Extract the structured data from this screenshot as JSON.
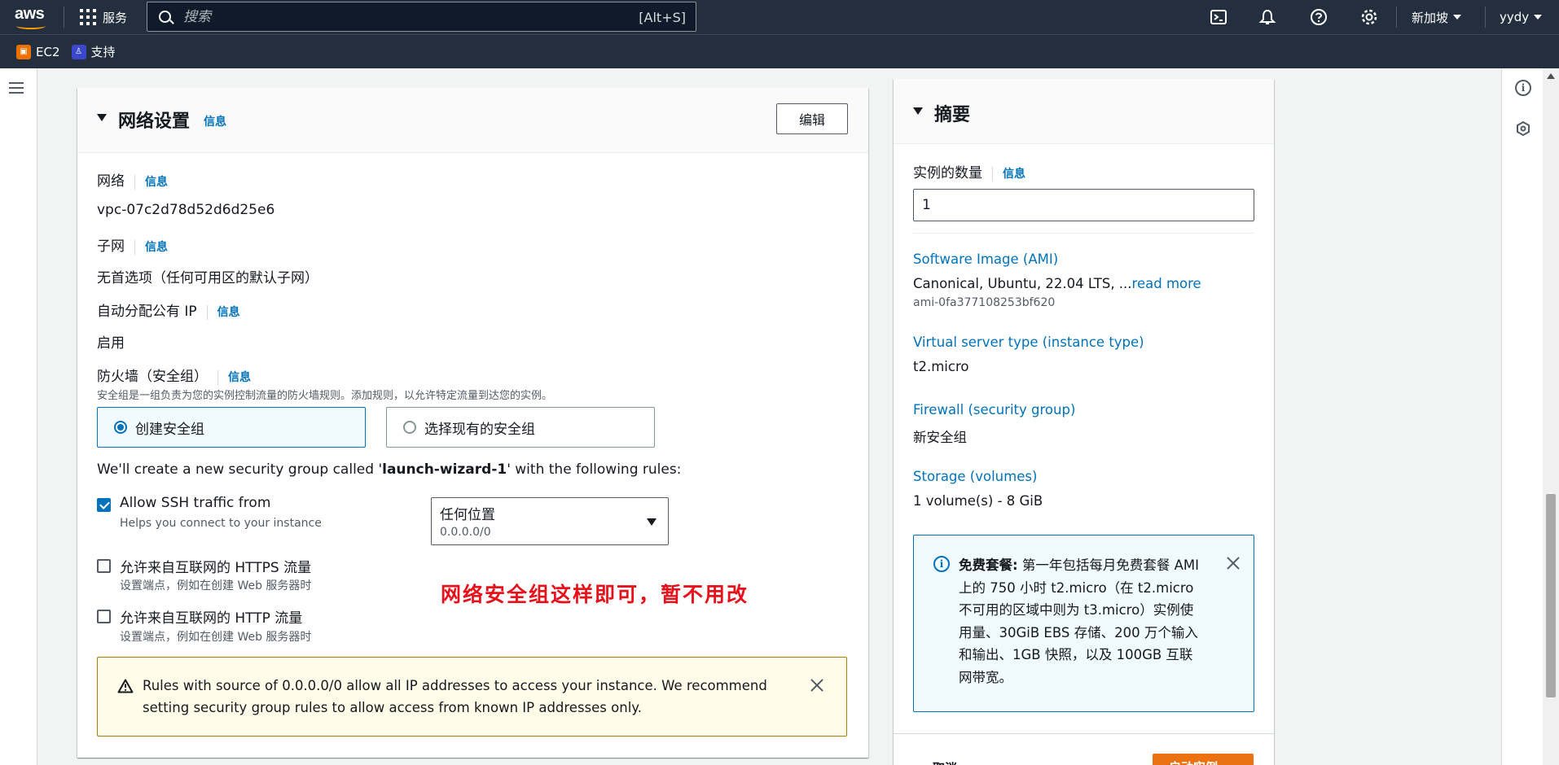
{
  "topnav": {
    "logo": "aws",
    "services_label": "服务",
    "search_placeholder": "搜索",
    "search_shortcut": "[Alt+S]",
    "region": "新加坡",
    "user": "yydy",
    "icons": [
      "cloudshell-icon",
      "bell-icon",
      "help-icon",
      "gear-icon"
    ]
  },
  "favorites": [
    {
      "label": "EC2",
      "color": "#ed7100"
    },
    {
      "label": "支持",
      "color": "#3b48cc"
    }
  ],
  "network": {
    "title": "网络设置",
    "info": "信息",
    "edit_button": "编辑",
    "network_label": "网络",
    "network_info": "信息",
    "network_value": "vpc-07c2d78d52d6d25e6",
    "subnet_label": "子网",
    "subnet_info": "信息",
    "subnet_value": "无首选项（任何可用区的默认子网）",
    "public_ip_label": "自动分配公有 IP",
    "public_ip_info": "信息",
    "public_ip_value": "启用",
    "firewall_label": "防火墙（安全组）",
    "firewall_info": "信息",
    "firewall_desc": "安全组是一组负责为您的实例控制流量的防火墙规则。添加规则，以允许特定流量到达您的实例。",
    "radio_create": "创建安全组",
    "radio_existing": "选择现有的安全组",
    "sg_sentence_pre": "We'll create a new security group called '",
    "sg_name": "launch-wizard-1",
    "sg_sentence_post": "' with the following rules:",
    "ssh_label": "Allow SSH traffic from",
    "ssh_desc": "Helps you connect to your instance",
    "ssh_checked": true,
    "source_value": "任何位置",
    "source_cidr": "0.0.0.0/0",
    "https_label": "允许来自互联网的 HTTPS 流量",
    "https_desc": "设置端点，例如在创建 Web 服务器时",
    "http_label": "允许来自互联网的 HTTP 流量",
    "http_desc": "设置端点，例如在创建 Web 服务器时",
    "annotation": "网络安全组这样即可，暂不用改",
    "warning_text": "Rules with source of 0.0.0.0/0 allow all IP addresses to access your instance. We recommend setting security group rules to allow access from known IP addresses only."
  },
  "summary": {
    "title": "摘要",
    "qty_label": "实例的数量",
    "qty_info": "信息",
    "qty_value": "1",
    "ami_label": "Software Image (AMI)",
    "ami_value": "Canonical, Ubuntu, 22.04 LTS, ...",
    "read_more": "read more",
    "ami_id": "ami-0fa377108253bf620",
    "type_label": "Virtual server type (instance type)",
    "type_value": "t2.micro",
    "fw_label": "Firewall (security group)",
    "fw_value": "新安全组",
    "storage_label": "Storage (volumes)",
    "storage_value": "1 volume(s) - 8 GiB",
    "free_bold": "免费套餐:",
    "free_text": " 第一年包括每月免费套餐 AMI 上的 750 小时 t2.micro（在 t2.micro 不可用的区域中则为 t3.micro）实例使用量、30GiB EBS 存储、200 万个输入和输出、1GB 快照，以及 100GB 互联网带宽。",
    "cancel": "取消",
    "launch": "启动实例"
  }
}
